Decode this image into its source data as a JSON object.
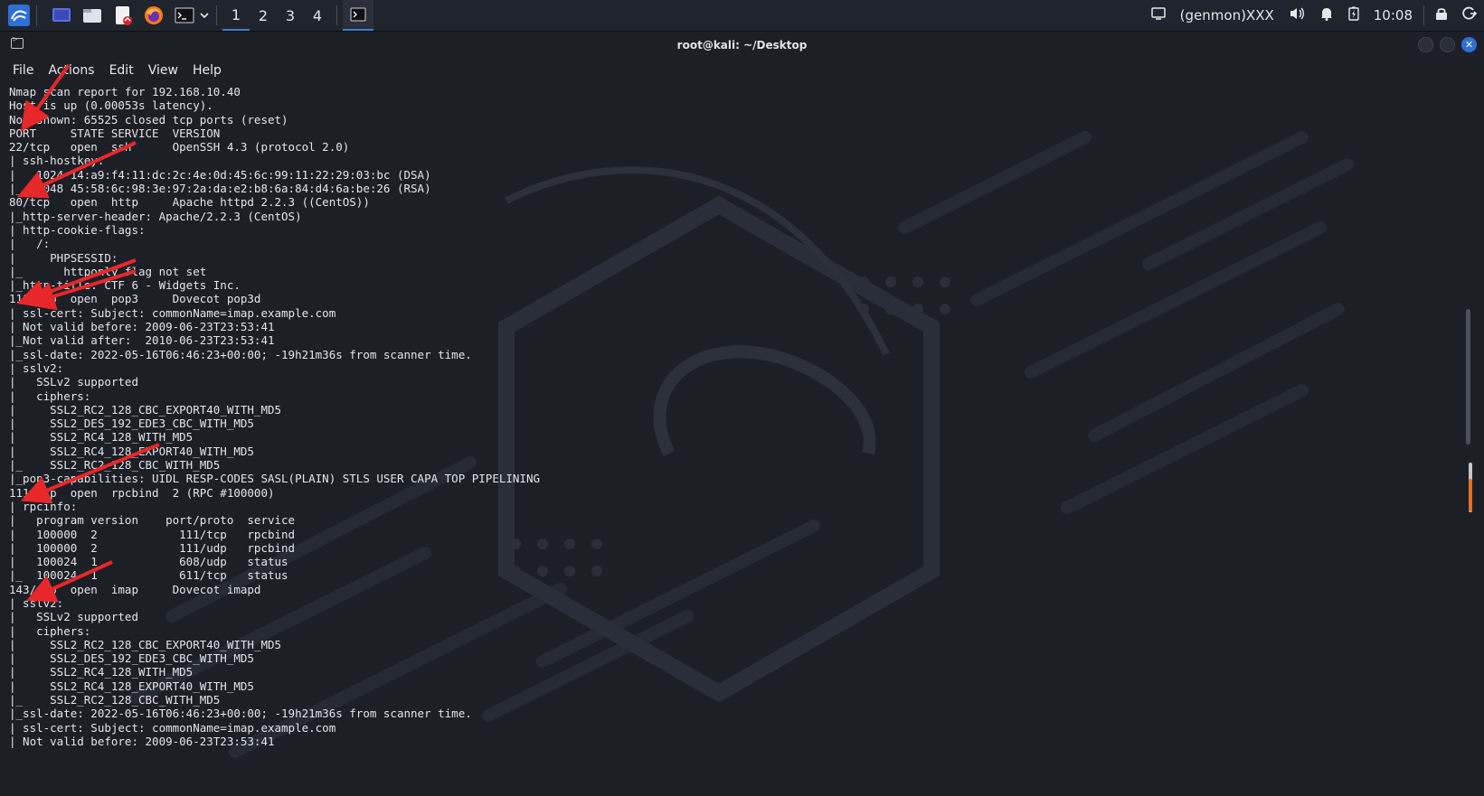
{
  "panel": {
    "workspaces": [
      "1",
      "2",
      "3",
      "4"
    ],
    "active_workspace": "1",
    "genmon": "(genmon)XXX",
    "clock": "10:08"
  },
  "window": {
    "title": "root@kali: ~/Desktop"
  },
  "menu": [
    "File",
    "Actions",
    "Edit",
    "View",
    "Help"
  ],
  "terminal": {
    "lines": [
      "Nmap scan report for 192.168.10.40",
      "Host is up (0.00053s latency).",
      "Not shown: 65525 closed tcp ports (reset)",
      "PORT     STATE SERVICE  VERSION",
      "22/tcp   open  ssh      OpenSSH 4.3 (protocol 2.0)",
      "| ssh-hostkey:",
      "|   1024 14:a9:f4:11:dc:2c:4e:0d:45:6c:99:11:22:29:03:bc (DSA)",
      "|_  2048 45:58:6c:98:3e:97:2a:da:e2:b8:6a:84:d4:6a:be:26 (RSA)",
      "80/tcp   open  http     Apache httpd 2.2.3 ((CentOS))",
      "|_http-server-header: Apache/2.2.3 (CentOS)",
      "| http-cookie-flags:",
      "|   /:",
      "|     PHPSESSID:",
      "|_      httponly flag not set",
      "|_http-title: CTF 6 - Widgets Inc.",
      "110/tcp  open  pop3     Dovecot pop3d",
      "| ssl-cert: Subject: commonName=imap.example.com",
      "| Not valid before: 2009-06-23T23:53:41",
      "|_Not valid after:  2010-06-23T23:53:41",
      "|_ssl-date: 2022-05-16T06:46:23+00:00; -19h21m36s from scanner time.",
      "| sslv2:",
      "|   SSLv2 supported",
      "|   ciphers:",
      "|     SSL2_RC2_128_CBC_EXPORT40_WITH_MD5",
      "|     SSL2_DES_192_EDE3_CBC_WITH_MD5",
      "|     SSL2_RC4_128_WITH_MD5",
      "|     SSL2_RC4_128_EXPORT40_WITH_MD5",
      "|_    SSL2_RC2_128_CBC_WITH_MD5",
      "|_pop3-capabilities: UIDL RESP-CODES SASL(PLAIN) STLS USER CAPA TOP PIPELINING",
      "111/tcp  open  rpcbind  2 (RPC #100000)",
      "| rpcinfo:",
      "|   program version    port/proto  service",
      "|   100000  2            111/tcp   rpcbind",
      "|   100000  2            111/udp   rpcbind",
      "|   100024  1            608/udp   status",
      "|_  100024  1            611/tcp   status",
      "143/tcp  open  imap     Dovecot imapd",
      "| sslv2:",
      "|   SSLv2 supported",
      "|   ciphers:",
      "|     SSL2_RC2_128_CBC_EXPORT40_WITH_MD5",
      "|     SSL2_DES_192_EDE3_CBC_WITH_MD5",
      "|     SSL2_RC4_128_WITH_MD5",
      "|     SSL2_RC4_128_EXPORT40_WITH_MD5",
      "|_    SSL2_RC2_128_CBC_WITH_MD5",
      "|_ssl-date: 2022-05-16T06:46:23+00:00; -19h21m36s from scanner time.",
      "| ssl-cert: Subject: commonName=imap.example.com",
      "| Not valid before: 2009-06-23T23:53:41"
    ]
  },
  "colors": {
    "panel_bg": "#20242d",
    "terminal_bg": "#1c1f26",
    "text": "#e3e5e8",
    "accent": "#2f6fd6",
    "annotation_arrow": "#e8272a"
  }
}
